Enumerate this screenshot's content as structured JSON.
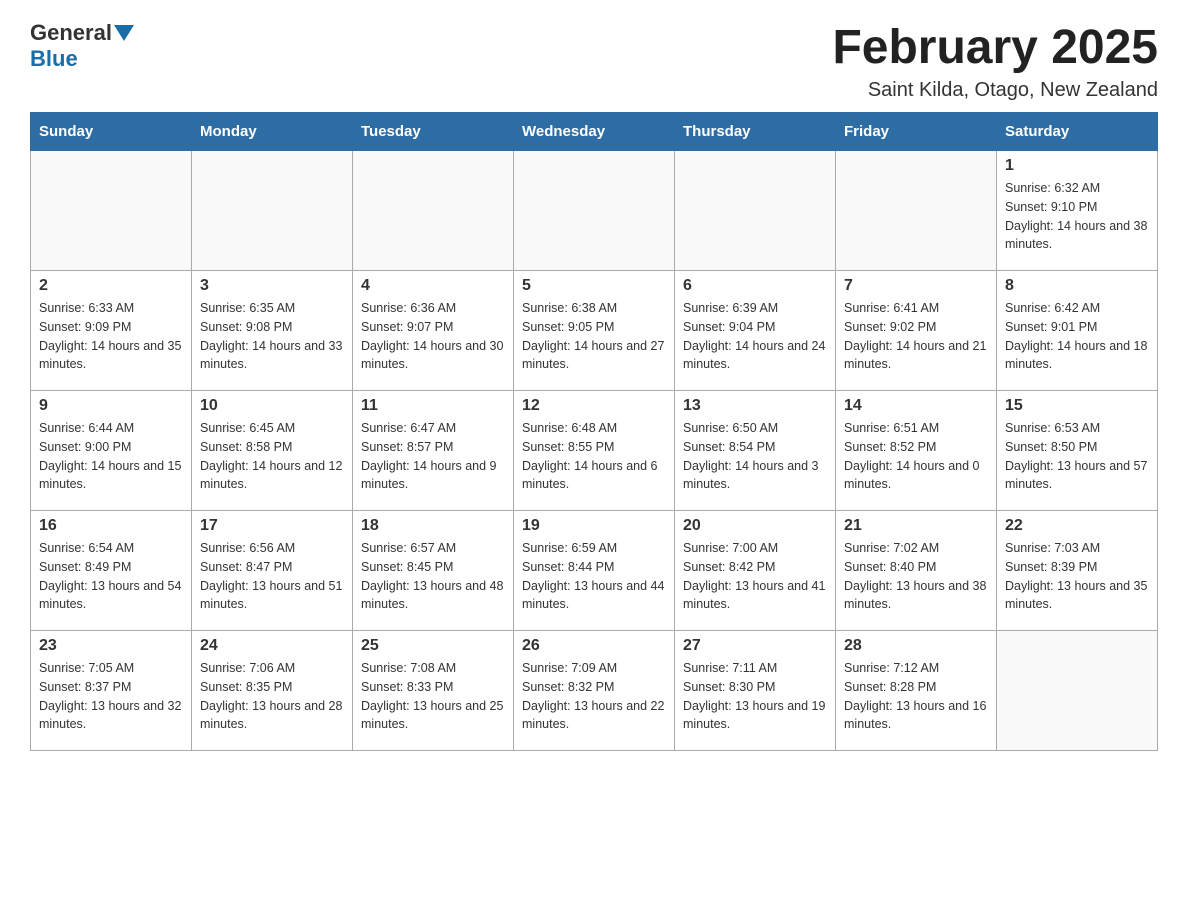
{
  "header": {
    "logo_general": "General",
    "logo_blue": "Blue",
    "month_title": "February 2025",
    "location": "Saint Kilda, Otago, New Zealand"
  },
  "days_of_week": [
    "Sunday",
    "Monday",
    "Tuesday",
    "Wednesday",
    "Thursday",
    "Friday",
    "Saturday"
  ],
  "weeks": [
    [
      {
        "day": "",
        "info": ""
      },
      {
        "day": "",
        "info": ""
      },
      {
        "day": "",
        "info": ""
      },
      {
        "day": "",
        "info": ""
      },
      {
        "day": "",
        "info": ""
      },
      {
        "day": "",
        "info": ""
      },
      {
        "day": "1",
        "info": "Sunrise: 6:32 AM\nSunset: 9:10 PM\nDaylight: 14 hours and 38 minutes."
      }
    ],
    [
      {
        "day": "2",
        "info": "Sunrise: 6:33 AM\nSunset: 9:09 PM\nDaylight: 14 hours and 35 minutes."
      },
      {
        "day": "3",
        "info": "Sunrise: 6:35 AM\nSunset: 9:08 PM\nDaylight: 14 hours and 33 minutes."
      },
      {
        "day": "4",
        "info": "Sunrise: 6:36 AM\nSunset: 9:07 PM\nDaylight: 14 hours and 30 minutes."
      },
      {
        "day": "5",
        "info": "Sunrise: 6:38 AM\nSunset: 9:05 PM\nDaylight: 14 hours and 27 minutes."
      },
      {
        "day": "6",
        "info": "Sunrise: 6:39 AM\nSunset: 9:04 PM\nDaylight: 14 hours and 24 minutes."
      },
      {
        "day": "7",
        "info": "Sunrise: 6:41 AM\nSunset: 9:02 PM\nDaylight: 14 hours and 21 minutes."
      },
      {
        "day": "8",
        "info": "Sunrise: 6:42 AM\nSunset: 9:01 PM\nDaylight: 14 hours and 18 minutes."
      }
    ],
    [
      {
        "day": "9",
        "info": "Sunrise: 6:44 AM\nSunset: 9:00 PM\nDaylight: 14 hours and 15 minutes."
      },
      {
        "day": "10",
        "info": "Sunrise: 6:45 AM\nSunset: 8:58 PM\nDaylight: 14 hours and 12 minutes."
      },
      {
        "day": "11",
        "info": "Sunrise: 6:47 AM\nSunset: 8:57 PM\nDaylight: 14 hours and 9 minutes."
      },
      {
        "day": "12",
        "info": "Sunrise: 6:48 AM\nSunset: 8:55 PM\nDaylight: 14 hours and 6 minutes."
      },
      {
        "day": "13",
        "info": "Sunrise: 6:50 AM\nSunset: 8:54 PM\nDaylight: 14 hours and 3 minutes."
      },
      {
        "day": "14",
        "info": "Sunrise: 6:51 AM\nSunset: 8:52 PM\nDaylight: 14 hours and 0 minutes."
      },
      {
        "day": "15",
        "info": "Sunrise: 6:53 AM\nSunset: 8:50 PM\nDaylight: 13 hours and 57 minutes."
      }
    ],
    [
      {
        "day": "16",
        "info": "Sunrise: 6:54 AM\nSunset: 8:49 PM\nDaylight: 13 hours and 54 minutes."
      },
      {
        "day": "17",
        "info": "Sunrise: 6:56 AM\nSunset: 8:47 PM\nDaylight: 13 hours and 51 minutes."
      },
      {
        "day": "18",
        "info": "Sunrise: 6:57 AM\nSunset: 8:45 PM\nDaylight: 13 hours and 48 minutes."
      },
      {
        "day": "19",
        "info": "Sunrise: 6:59 AM\nSunset: 8:44 PM\nDaylight: 13 hours and 44 minutes."
      },
      {
        "day": "20",
        "info": "Sunrise: 7:00 AM\nSunset: 8:42 PM\nDaylight: 13 hours and 41 minutes."
      },
      {
        "day": "21",
        "info": "Sunrise: 7:02 AM\nSunset: 8:40 PM\nDaylight: 13 hours and 38 minutes."
      },
      {
        "day": "22",
        "info": "Sunrise: 7:03 AM\nSunset: 8:39 PM\nDaylight: 13 hours and 35 minutes."
      }
    ],
    [
      {
        "day": "23",
        "info": "Sunrise: 7:05 AM\nSunset: 8:37 PM\nDaylight: 13 hours and 32 minutes."
      },
      {
        "day": "24",
        "info": "Sunrise: 7:06 AM\nSunset: 8:35 PM\nDaylight: 13 hours and 28 minutes."
      },
      {
        "day": "25",
        "info": "Sunrise: 7:08 AM\nSunset: 8:33 PM\nDaylight: 13 hours and 25 minutes."
      },
      {
        "day": "26",
        "info": "Sunrise: 7:09 AM\nSunset: 8:32 PM\nDaylight: 13 hours and 22 minutes."
      },
      {
        "day": "27",
        "info": "Sunrise: 7:11 AM\nSunset: 8:30 PM\nDaylight: 13 hours and 19 minutes."
      },
      {
        "day": "28",
        "info": "Sunrise: 7:12 AM\nSunset: 8:28 PM\nDaylight: 13 hours and 16 minutes."
      },
      {
        "day": "",
        "info": ""
      }
    ]
  ]
}
